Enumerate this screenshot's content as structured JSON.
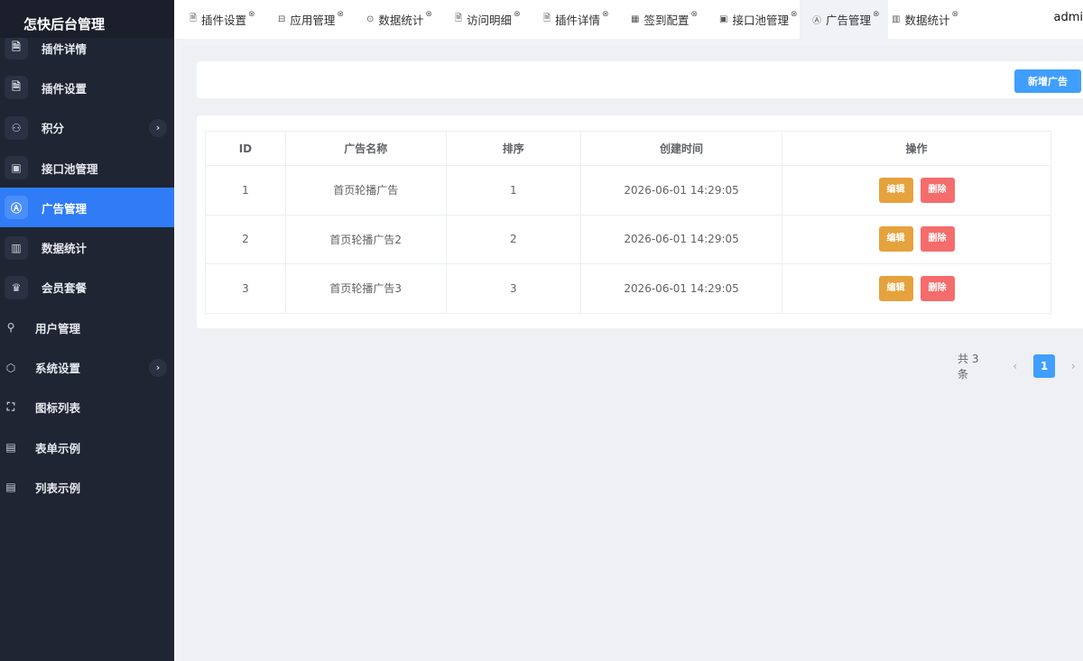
{
  "app": {
    "title": "怎快后台管理",
    "user": "admi"
  },
  "sidebar": {
    "items": [
      {
        "label": "插件详情",
        "icon": "file-doc-icon",
        "glyph": "🗎",
        "level": 2,
        "active": false,
        "expandable": false
      },
      {
        "label": "插件设置",
        "icon": "file-settings-icon",
        "glyph": "🗎",
        "level": 2,
        "active": false,
        "expandable": false
      },
      {
        "label": "积分",
        "icon": "points-icon",
        "glyph": "⚇",
        "level": 2,
        "active": false,
        "expandable": true
      },
      {
        "label": "接口池管理",
        "icon": "api-pool-icon",
        "glyph": "▣",
        "level": 2,
        "active": false,
        "expandable": false
      },
      {
        "label": "广告管理",
        "icon": "ad-icon",
        "glyph": "Ⓐ",
        "level": 2,
        "active": true,
        "expandable": false
      },
      {
        "label": "数据统计",
        "icon": "chart-icon",
        "glyph": "▥",
        "level": 2,
        "active": false,
        "expandable": false
      },
      {
        "label": "会员套餐",
        "icon": "crown-icon",
        "glyph": "♛",
        "level": 2,
        "active": false,
        "expandable": false
      },
      {
        "label": "用户管理",
        "icon": "user-icon",
        "glyph": "⚲",
        "level": 1,
        "active": false,
        "expandable": false
      },
      {
        "label": "系统设置",
        "icon": "gear-icon",
        "glyph": "⬡",
        "level": 1,
        "active": false,
        "expandable": true
      },
      {
        "label": "图标列表",
        "icon": "image-icon",
        "glyph": "⛶",
        "level": 1,
        "active": false,
        "expandable": false
      },
      {
        "label": "表单示例",
        "icon": "form-icon",
        "glyph": "▤",
        "level": 1,
        "active": false,
        "expandable": false
      },
      {
        "label": "列表示例",
        "icon": "list-icon",
        "glyph": "▤",
        "level": 1,
        "active": false,
        "expandable": false
      }
    ],
    "arrow_glyph": "›"
  },
  "tabs": [
    {
      "label": "插件设置",
      "icon": "file-icon",
      "glyph": "🗎",
      "active": false
    },
    {
      "label": "应用管理",
      "icon": "app-icon",
      "glyph": "⊟",
      "active": false
    },
    {
      "label": "数据统计",
      "icon": "stats-icon",
      "glyph": "⊙",
      "active": false
    },
    {
      "label": "访问明细",
      "icon": "doc-icon",
      "glyph": "🗎",
      "active": false
    },
    {
      "label": "插件详情",
      "icon": "file-icon",
      "glyph": "🗎",
      "active": false
    },
    {
      "label": "签到配置",
      "icon": "calendar-icon",
      "glyph": "▦",
      "active": false
    },
    {
      "label": "接口池管理",
      "icon": "api-icon",
      "glyph": "▣",
      "active": false
    },
    {
      "label": "广告管理",
      "icon": "ad-icon",
      "glyph": "Ⓐ",
      "active": true
    },
    {
      "label": "数据统计",
      "icon": "chart-icon",
      "glyph": "▥",
      "active": false
    }
  ],
  "tab_close_glyph": "⊗",
  "toolbar": {
    "add_label": "新增广告"
  },
  "table": {
    "headers": [
      "ID",
      "广告名称",
      "排序",
      "创建时间",
      "操作"
    ],
    "rows": [
      {
        "id": "1",
        "name": "首页轮播广告",
        "sort": "1",
        "created": "2026-06-01 14:29:05"
      },
      {
        "id": "2",
        "name": "首页轮播广告2",
        "sort": "2",
        "created": "2026-06-01 14:29:05"
      },
      {
        "id": "3",
        "name": "首页轮播广告3",
        "sort": "3",
        "created": "2026-06-01 14:29:05"
      }
    ],
    "edit_label": "编辑",
    "delete_label": "删除"
  },
  "pagination": {
    "total": "共 3 条",
    "current_page": "1",
    "prev_glyph": "‹",
    "next_glyph": "›"
  },
  "colors": {
    "sidebar_bg": "#1f2533",
    "accent": "#2f7cf6",
    "primary": "#409eff",
    "warning": "#e6a23c",
    "danger": "#f56c6c"
  }
}
